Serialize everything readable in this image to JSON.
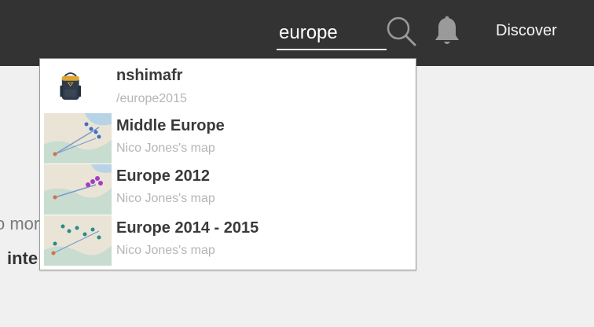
{
  "header": {
    "search_value": "europe",
    "discover_label": "Discover"
  },
  "background": {
    "line1": "o mor",
    "line2": "inte"
  },
  "results": [
    {
      "title": "nshimafr",
      "subtitle": "/europe2015",
      "icon": "backpack-icon"
    },
    {
      "title": "Middle Europe",
      "subtitle": "Nico Jones's map",
      "icon": "map-thumbnail"
    },
    {
      "title": "Europe 2012",
      "subtitle": "Nico Jones's map",
      "icon": "map-thumbnail"
    },
    {
      "title": "Europe 2014 - 2015",
      "subtitle": "Nico Jones's map",
      "icon": "map-thumbnail"
    }
  ]
}
